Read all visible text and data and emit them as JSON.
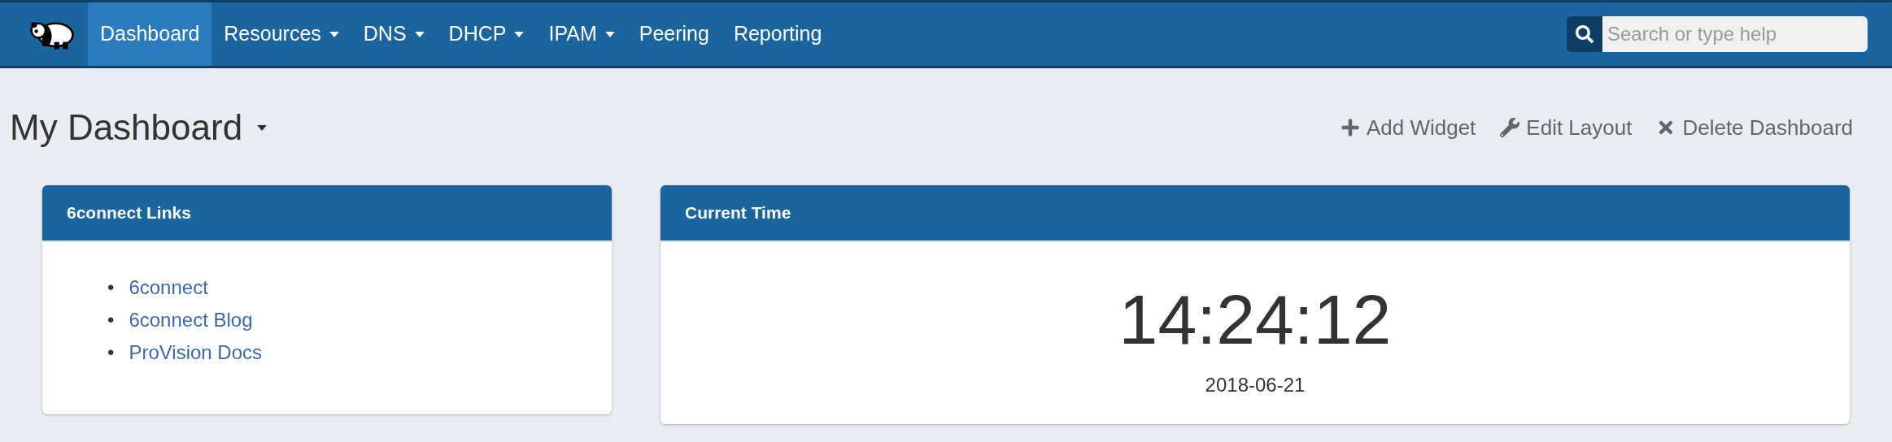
{
  "nav": {
    "items": [
      {
        "label": "Dashboard",
        "selected": true,
        "dropdown": false
      },
      {
        "label": "Resources",
        "selected": false,
        "dropdown": true
      },
      {
        "label": "DNS",
        "selected": false,
        "dropdown": true
      },
      {
        "label": "DHCP",
        "selected": false,
        "dropdown": true
      },
      {
        "label": "IPAM",
        "selected": false,
        "dropdown": true
      },
      {
        "label": "Peering",
        "selected": false,
        "dropdown": false
      },
      {
        "label": "Reporting",
        "selected": false,
        "dropdown": false
      }
    ],
    "search": {
      "placeholder": "Search or type help"
    }
  },
  "dashboard": {
    "title": "My Dashboard",
    "actions": [
      {
        "kind": "add",
        "label": "Add Widget"
      },
      {
        "kind": "edit",
        "label": "Edit Layout"
      },
      {
        "kind": "delete",
        "label": "Delete Dashboard"
      }
    ]
  },
  "widgets": [
    {
      "kind": "links",
      "title": "6connect Links",
      "links": [
        {
          "bullet": "•",
          "label": "6connect"
        },
        {
          "bullet": "•",
          "label": "6connect Blog"
        },
        {
          "bullet": "•",
          "label": "ProVision Docs"
        }
      ]
    },
    {
      "kind": "clock",
      "title": "Current Time",
      "time": "14:24:12",
      "date": "2018-06-21"
    }
  ]
}
